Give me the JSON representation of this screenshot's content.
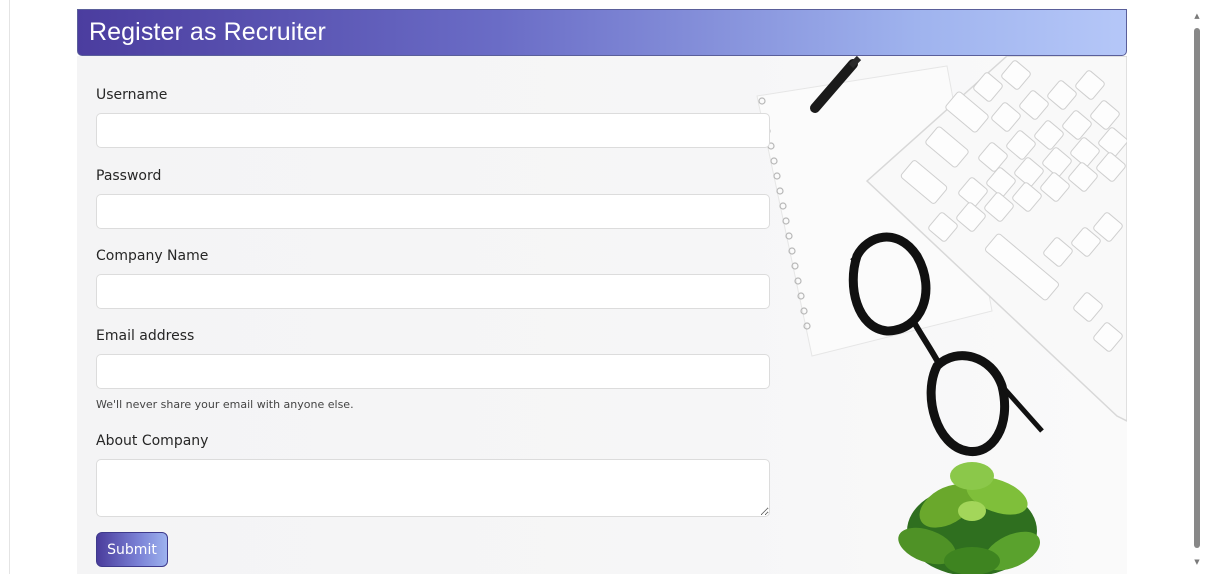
{
  "header": {
    "title": "Register as Recruiter"
  },
  "form": {
    "username_label": "Username",
    "username_value": "",
    "password_label": "Password",
    "password_value": "",
    "company_name_label": "Company Name",
    "company_name_value": "",
    "email_label": "Email address",
    "email_value": "",
    "email_help": "We'll never share your email with anyone else.",
    "about_company_label": "About Company",
    "about_company_value": "",
    "submit_label": "Submit"
  },
  "background_image": {
    "description_icons": [
      "keyboard-icon",
      "notebook-icon",
      "glasses-icon",
      "pen-icon",
      "succulent-plant-icon"
    ]
  },
  "scrollbar": {
    "up_icon": "▲",
    "down_icon": "▼"
  },
  "colors": {
    "header_gradient_start": "#4b3d9f",
    "header_gradient_end": "#b5c7f8",
    "panel_background": "#f4f4f5",
    "button_gradient_start": "#4a3c9c",
    "button_gradient_end": "#9db2ee"
  }
}
